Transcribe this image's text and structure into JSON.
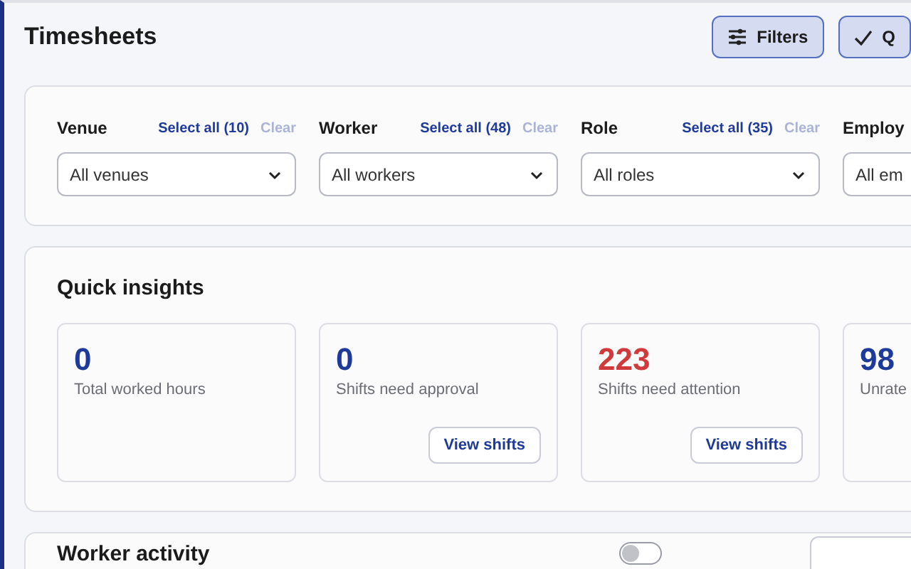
{
  "page": {
    "title": "Timesheets"
  },
  "header_buttons": [
    {
      "kind": "filters",
      "label": "Filters",
      "selected": true
    },
    {
      "kind": "check",
      "label": "Q",
      "selected": true
    }
  ],
  "filters": [
    {
      "label": "Venue",
      "select_all": "Select all (10)",
      "clear": "Clear",
      "value": "All venues"
    },
    {
      "label": "Worker",
      "select_all": "Select all (48)",
      "clear": "Clear",
      "value": "All workers"
    },
    {
      "label": "Role",
      "select_all": "Select all (35)",
      "clear": "Clear",
      "value": "All roles"
    },
    {
      "label": "Employ",
      "value": "All em"
    }
  ],
  "quick_insights": {
    "title": "Quick insights",
    "tiles": [
      {
        "value": "0",
        "label": "Total worked hours",
        "alert": false
      },
      {
        "value": "0",
        "label": "Shifts need approval",
        "alert": false,
        "button": "View shifts"
      },
      {
        "value": "223",
        "label": "Shifts need attention",
        "alert": true,
        "button": "View shifts"
      },
      {
        "value": "98",
        "label": "Unrate",
        "alert": false
      }
    ]
  },
  "worker_activity": {
    "title": "Worker activity",
    "toggle": {
      "on": false
    }
  }
}
